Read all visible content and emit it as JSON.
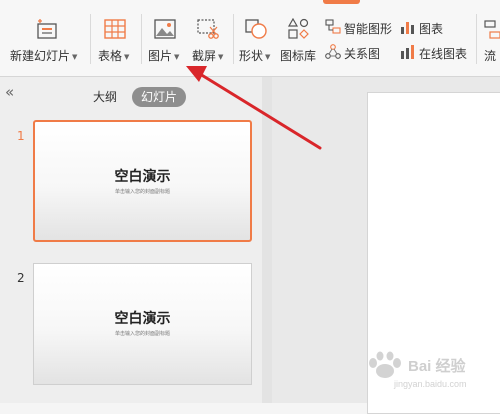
{
  "ribbon": {
    "new_slide": "新建幻灯片",
    "table": "表格",
    "picture": "图片",
    "screenshot": "截屏",
    "shape": "形状",
    "icon_library": "图标库",
    "smart_graphic": "智能图形",
    "relation_graph": "关系图",
    "chart": "图表",
    "online_chart": "在线图表",
    "flow": "流"
  },
  "side_panel": {
    "outline_tab": "大纲",
    "slides_tab": "幻灯片",
    "slides": [
      {
        "number": "1",
        "title": "空白演示",
        "subtitle": "单击输入您的封面副标题"
      },
      {
        "number": "2",
        "title": "空白演示",
        "subtitle": "单击输入您的封面副标题"
      }
    ]
  },
  "watermark": {
    "text": "Bai 经验",
    "sub": "jingyan.baidu.com"
  },
  "colors": {
    "accent": "#f07b47",
    "arrow": "#d9262a"
  }
}
